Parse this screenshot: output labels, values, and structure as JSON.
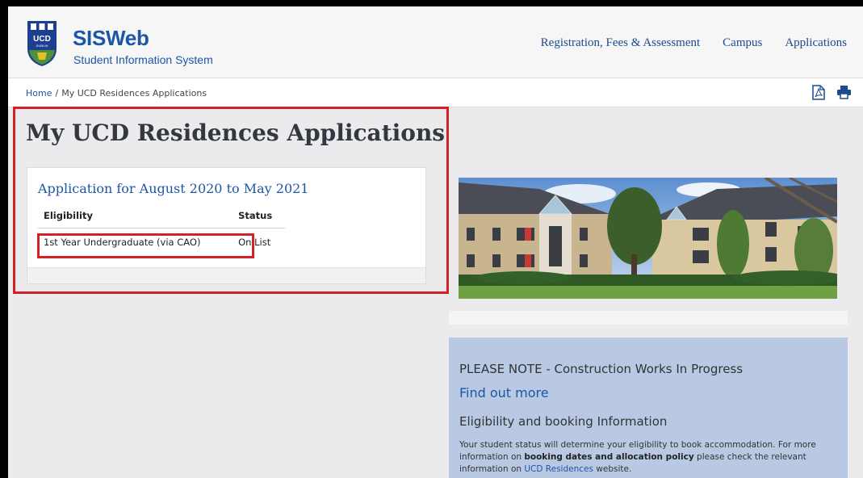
{
  "brand": {
    "title": "SISWeb",
    "subtitle": "Student Information System",
    "crest_text": "UCD"
  },
  "nav": {
    "items": [
      "Registration, Fees & Assessment",
      "Campus",
      "Applications"
    ]
  },
  "breadcrumb": {
    "home": "Home",
    "separator": "/",
    "current": "My UCD Residences Applications"
  },
  "toolbar": {
    "icons": [
      "pdf-icon",
      "print-icon"
    ]
  },
  "page": {
    "title": "My UCD Residences Applications"
  },
  "application": {
    "heading": "Application for August 2020 to May 2021",
    "columns": [
      "Eligibility",
      "Status"
    ],
    "rows": [
      {
        "eligibility": "1st Year Undergraduate (via CAO)",
        "status": "On List"
      }
    ]
  },
  "notice": {
    "title": "PLEASE NOTE - Construction Works In Progress",
    "link": "Find out more",
    "subheading": "Eligibility and booking Information",
    "body_1": "Your student status will determine your eligibility to book accommodation. For more information on ",
    "body_bold": "booking dates and allocation policy",
    "body_2": " please check the relevant information on ",
    "body_link": "UCD Residences",
    "body_3": " website."
  },
  "colors": {
    "brand_blue": "#1b57a5",
    "highlight_red": "#d42027",
    "notice_bg": "#b9c9e3"
  }
}
